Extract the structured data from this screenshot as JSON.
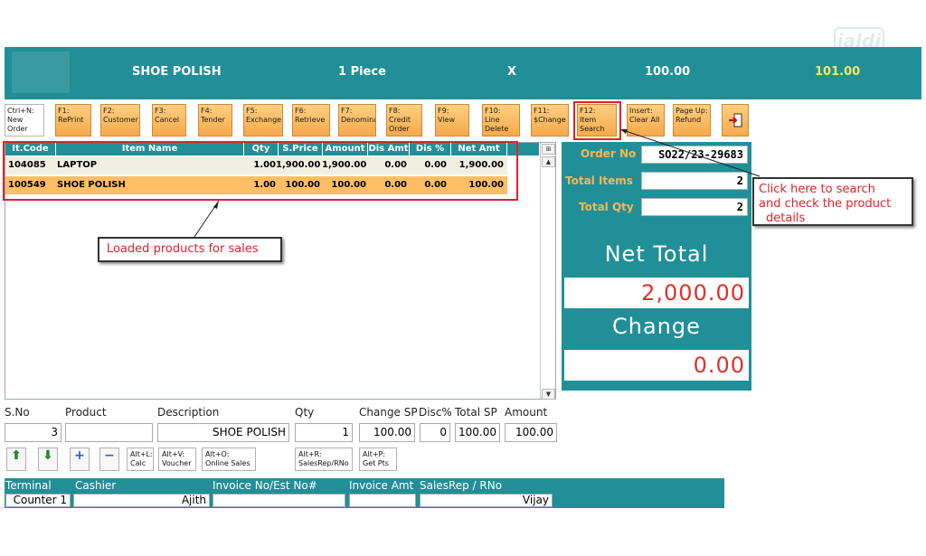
{
  "watermark": "jaldi",
  "header": {
    "product": "SHOE POLISH",
    "quantity": "1 Piece",
    "multiplier": "X",
    "price": "100.00",
    "total": "101.00"
  },
  "function_keys": [
    {
      "line1": "Ctrl+N:",
      "line2": "New",
      "line3": "Order"
    },
    {
      "line1": "F1:",
      "line2": "RePrint"
    },
    {
      "line1": "F2:",
      "line2": "Customer"
    },
    {
      "line1": "F3:",
      "line2": "Cancel"
    },
    {
      "line1": "F4:",
      "line2": "Tender"
    },
    {
      "line1": "F5:",
      "line2": "Exchange"
    },
    {
      "line1": "F6:",
      "line2": "Retrieve"
    },
    {
      "line1": "F7:",
      "line2": "Denomina"
    },
    {
      "line1": "F8:",
      "line2": "Credit",
      "line3": "Order"
    },
    {
      "line1": "F9:",
      "line2": "View"
    },
    {
      "line1": "F10:",
      "line2": "Line",
      "line3": "Delete"
    },
    {
      "line1": "F11:",
      "line2": "$Change"
    },
    {
      "line1": "F12:",
      "line2": "Item",
      "line3": "Search"
    },
    {
      "line1": "Insert:",
      "line2": "Clear All"
    },
    {
      "line1": "Page Up:",
      "line2": "Refund"
    }
  ],
  "table": {
    "columns": [
      "It.Code",
      "Item Name",
      "Qty",
      "S.Price",
      "Amount",
      "Dis Amt",
      "Dis %",
      "Net Amt"
    ],
    "rows": [
      [
        "104085",
        "LAPTOP",
        "1.00",
        "1,900.00",
        "1,900.00",
        "0.00",
        "0.00",
        "1,900.00"
      ],
      [
        "100549",
        "SHOE POLISH",
        "1.00",
        "100.00",
        "100.00",
        "0.00",
        "0.00",
        "100.00"
      ]
    ]
  },
  "summary": {
    "order_no_label": "Order No",
    "order_no": "SO22/23-29683",
    "total_items_label": "Total Items",
    "total_items": "2",
    "total_qty_label": "Total Qty",
    "total_qty": "2",
    "net_total_label": "Net Total",
    "net_total": "2,000.00",
    "change_label": "Change",
    "change": "0.00"
  },
  "callouts": {
    "loaded": "Loaded products for sales",
    "search_line1": "Click here to search",
    "search_line2": "and check the product",
    "search_line3": "details"
  },
  "entry": {
    "labels": [
      "S.No",
      "Product",
      "Description",
      "Qty",
      "Change SP",
      "Disc%",
      "Total SP",
      "Amount"
    ],
    "sno": "3",
    "product": "",
    "description": "SHOE POLISH",
    "qty": "1",
    "change_sp": "100.00",
    "disc": "0",
    "total_sp": "100.00",
    "amount": "100.00"
  },
  "small_buttons": {
    "calc": [
      "Alt+L:",
      "Calc"
    ],
    "voucher": [
      "Alt+V:",
      "Voucher"
    ],
    "online": [
      "Alt+O:",
      "Online Sales"
    ],
    "salesrep": [
      "Alt+R:",
      "SalesRep/RNo"
    ],
    "getpts": [
      "Alt+P:",
      "Get Pts"
    ]
  },
  "footer": {
    "terminal_label": "Terminal",
    "terminal": "Counter 1",
    "cashier_label": "Cashier",
    "cashier": "Ajith",
    "invoice_no_label": "Invoice No/Est No#",
    "invoice_no": "",
    "invoice_amt_label": "Invoice Amt",
    "invoice_amt": "",
    "salesrep_label": "SalesRep / RNo",
    "salesrep": "Vijay"
  },
  "colors": {
    "teal": "#218f97",
    "orange": "#ffbe63",
    "red": "#e0212b",
    "yellow": "#f4e66a"
  }
}
